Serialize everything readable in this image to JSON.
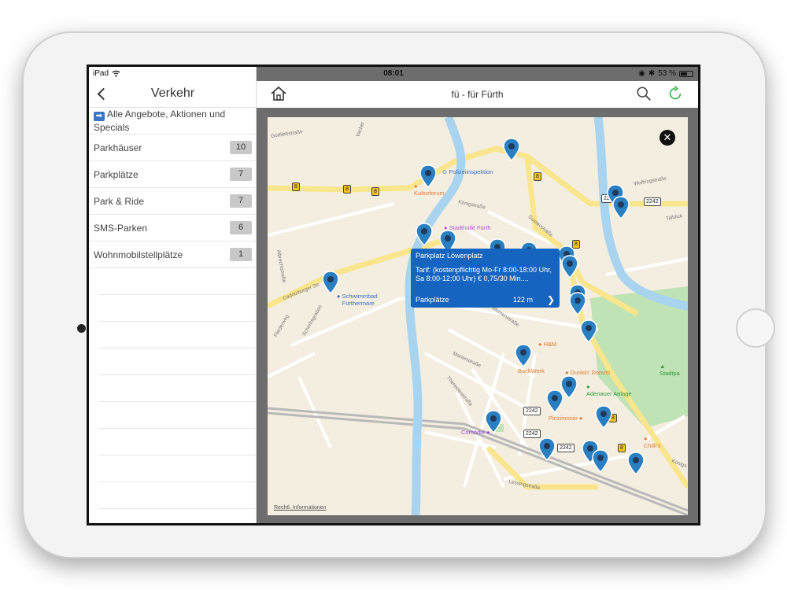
{
  "status_bar": {
    "device": "iPad",
    "time": "08:01",
    "battery": "53 %"
  },
  "sidebar": {
    "title": "Verkehr",
    "special": {
      "icon": "right-arrow-icon",
      "label": "Alle Angebote, Aktionen und Specials"
    },
    "items": [
      {
        "label": "Parkhäuser",
        "count": "10"
      },
      {
        "label": "Parkplätze",
        "count": "7"
      },
      {
        "label": "Park & Ride",
        "count": "7"
      },
      {
        "label": "SMS-Parken",
        "count": "6"
      },
      {
        "label": "Wohnmobilstellplätze",
        "count": "1"
      }
    ]
  },
  "header": {
    "title": "fü - für Fürth"
  },
  "map": {
    "legal": "Rechtl. Informationen",
    "popup": {
      "title": "Parkplatz Löwenplatz",
      "description": "Tarif: (kostenpflichtig Mo-Fr 8:00-18:00 Uhr, Sa 8:00-12:00 Uhr) € 0,75/30 Min....",
      "category": "Parkplätze",
      "distance": "122 m"
    },
    "pois": {
      "polizei": "Polizeiinspektion",
      "kulturforum": "Kulturforum",
      "stadthalle": "Stadthalle Fürth",
      "schwimmbad": "Schwimmbad Fürthermare",
      "hm": "H&M",
      "backwerk": "BackWerk",
      "dunkin": "Dunkin' Donuts",
      "adenauer": "Adenauer Anlage",
      "stadtpark": "Stadtpa",
      "pinzimonio": "Pinzimonio",
      "comoedie": "Comödie",
      "chillis": "Chilli's"
    },
    "streets": {
      "koenigstrasse": "Königstraße",
      "gustavstrasse": "Gustavstraße",
      "wolfringstrasse": "Wolfringstraße",
      "cadolzburger": "Cadolzburger Str.",
      "fliederweg": "Fliederweg",
      "marienstrasse": "Marienstraße",
      "theresienstrasse": "Theresienstraße",
      "lessingstrasse": "Lessingstraße",
      "blumenstrasse": "Blumenstraße",
      "albrechtstrasse": "Albrechtstraße",
      "scherbsgraben": "Scherbsgraben",
      "gottliebstrasse": "Gottliebstraße",
      "vacher": "Vacher",
      "tulbeck": "Talblick",
      "koenigs2": "Königs"
    },
    "road_badges": [
      "8",
      "8",
      "8",
      "8",
      "8",
      "8",
      "8",
      "2242",
      "2242",
      "2242",
      "2242",
      "2242"
    ]
  },
  "colors": {
    "pin": "#2a7fc1",
    "popup": "#1565c0",
    "river": "#a8d4f0",
    "park": "#bfe3b4",
    "road_major": "#f9e58c"
  }
}
